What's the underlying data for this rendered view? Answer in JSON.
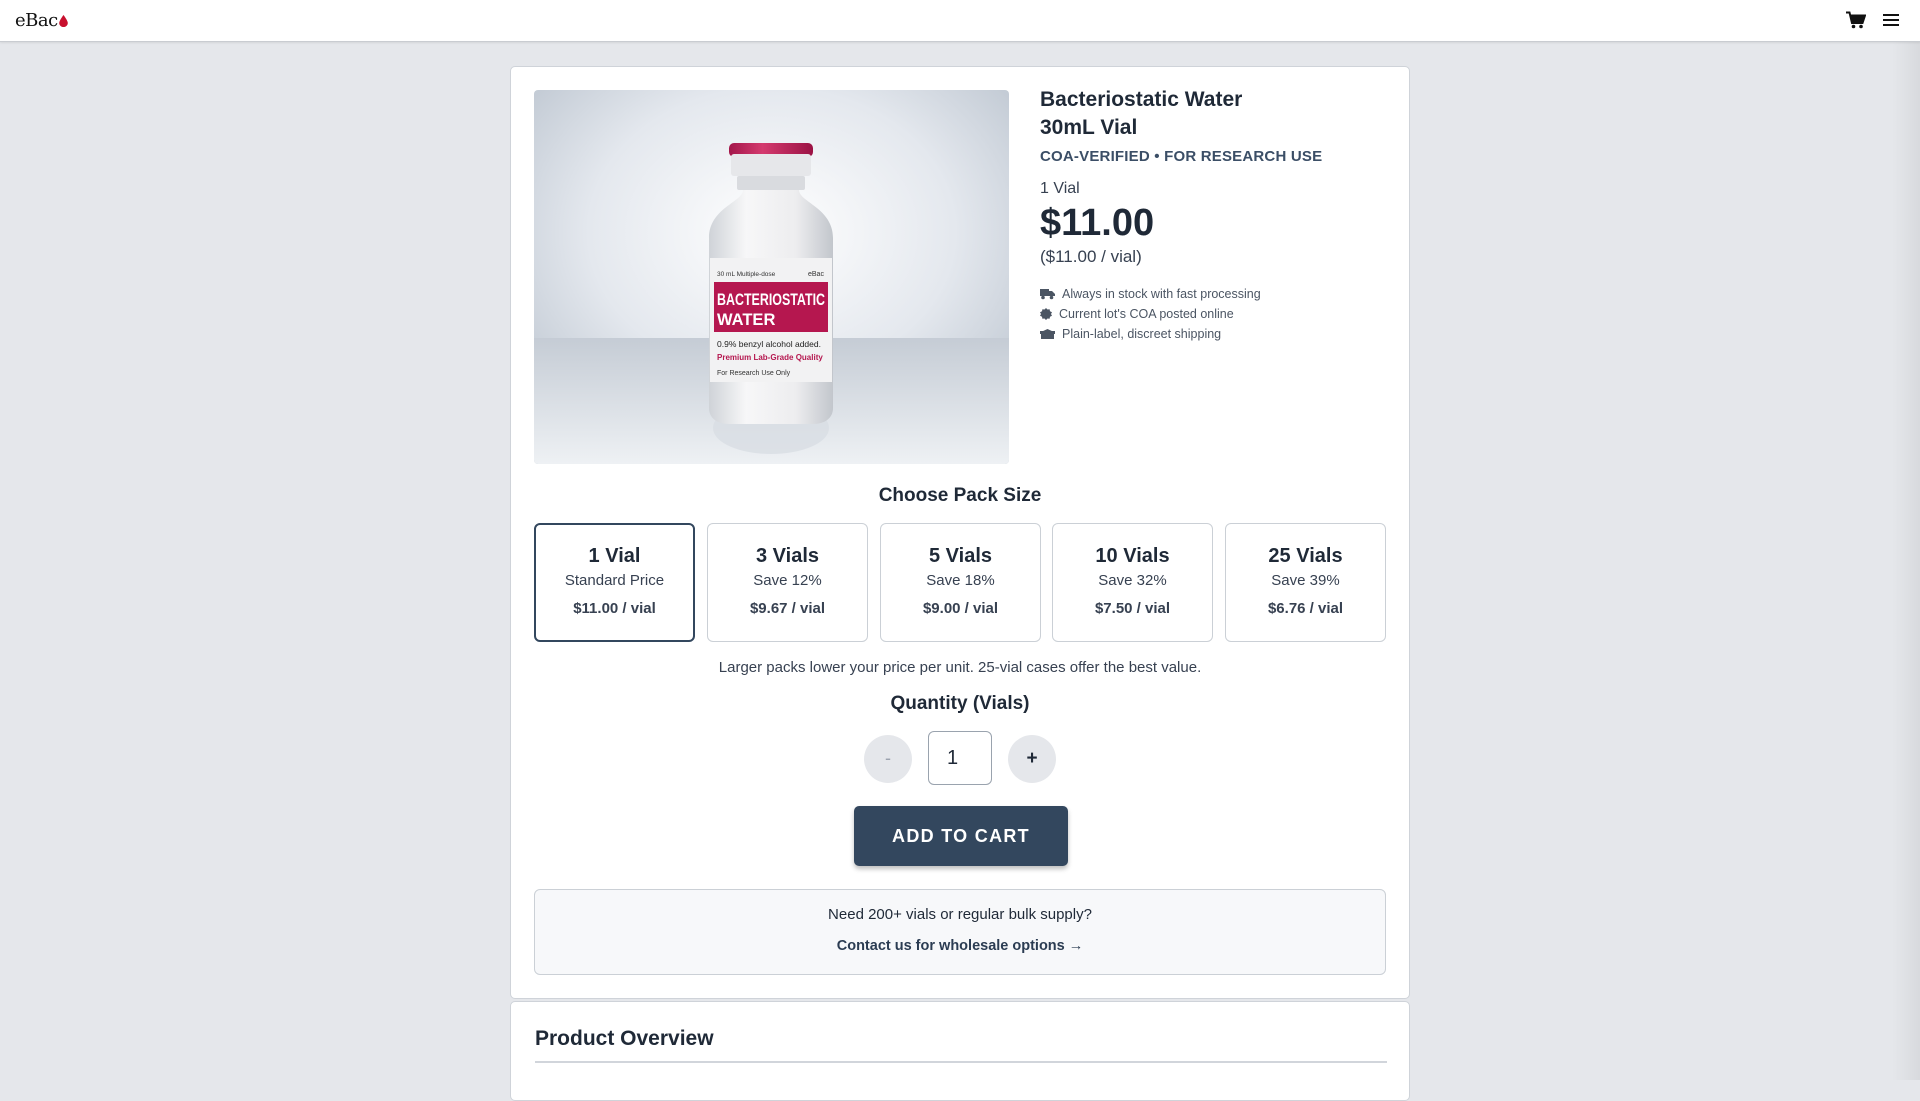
{
  "nav": {
    "logo_text": "eBac",
    "cart_icon": "cart-icon",
    "menu_icon": "hamburger-menu-icon"
  },
  "product": {
    "title_line1": "Bacteriostatic Water",
    "title_line2": "30mL Vial",
    "tagline": "COA-VERIFIED • FOR RESEARCH USE",
    "selected_pack_label": "1 Vial",
    "price": "$11.00",
    "unit_price": "($11.00 / vial)",
    "image": {
      "bottle_top_text": "30 mL Multiple-dose",
      "bottle_brand": "eBac",
      "label_line1": "BACTERIOSTATIC",
      "label_line2": "WATER",
      "label_line3": "0.9% benzyl alcohol added.",
      "label_line4": "Premium Lab-Grade Quality",
      "label_line5": "For Research Use Only"
    },
    "features": [
      {
        "icon": "truck-icon",
        "text": "Always in stock with fast processing"
      },
      {
        "icon": "badge-icon",
        "text": "Current lot's COA posted online"
      },
      {
        "icon": "box-icon",
        "text": "Plain-label, discreet shipping"
      }
    ]
  },
  "packs": {
    "heading": "Choose Pack Size",
    "options": [
      {
        "name": "1 Vial",
        "savings": "Standard Price",
        "price": "$11.00 / vial",
        "selected": true
      },
      {
        "name": "3 Vials",
        "savings": "Save 12%",
        "price": "$9.67 / vial",
        "selected": false
      },
      {
        "name": "5 Vials",
        "savings": "Save 18%",
        "price": "$9.00 / vial",
        "selected": false
      },
      {
        "name": "10 Vials",
        "savings": "Save 32%",
        "price": "$7.50 / vial",
        "selected": false
      },
      {
        "name": "25 Vials",
        "savings": "Save 39%",
        "price": "$6.76 / vial",
        "selected": false
      }
    ],
    "hint": "Larger packs lower your price per unit. 25-vial cases offer the best value."
  },
  "quantity": {
    "heading": "Quantity (Vials)",
    "minus_label": "-",
    "value": "1",
    "plus_label": "+"
  },
  "cart": {
    "add_label": "ADD TO CART"
  },
  "wholesale": {
    "question": "Need 200+ vials or regular bulk supply?",
    "link_label": "Contact us for wholesale options →"
  },
  "overview": {
    "title": "Product Overview"
  },
  "colors": {
    "accent": "#33475e",
    "brand_drop": "#c8102e",
    "page_background": "#e5e7eb"
  }
}
